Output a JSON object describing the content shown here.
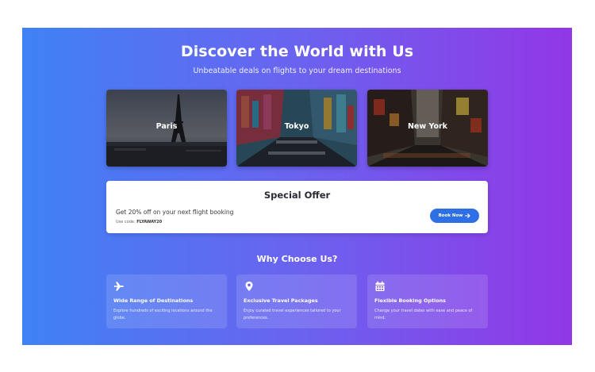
{
  "hero": {
    "title": "Discover the World with Us",
    "subtitle": "Unbeatable deals on flights to your dream destinations"
  },
  "destinations": [
    {
      "name": "Paris",
      "image": "eiffel-tower-image"
    },
    {
      "name": "Tokyo",
      "image": "tokyo-street-image"
    },
    {
      "name": "New York",
      "image": "new-york-street-image"
    }
  ],
  "offer": {
    "title": "Special Offer",
    "text": "Get 20% off on your next flight booking",
    "code_label": "Use code: ",
    "code": "FLYAWAY20",
    "button_label": "Book Now",
    "button_icon": "arrow-right-icon"
  },
  "why": {
    "title": "Why Choose Us?",
    "features": [
      {
        "icon": "plane-icon",
        "title": "Wide Range of Destinations",
        "description": "Explore hundreds of exciting locations around the globe."
      },
      {
        "icon": "map-pin-icon",
        "title": "Exclusive Travel Packages",
        "description": "Enjoy curated travel experiences tailored to your preferences."
      },
      {
        "icon": "calendar-icon",
        "title": "Flexible Booking Options",
        "description": "Change your travel dates with ease and peace of mind."
      }
    ]
  },
  "colors": {
    "gradient_start": "#3f82f5",
    "gradient_end": "#9237e6",
    "button": "#2e6fe6"
  }
}
